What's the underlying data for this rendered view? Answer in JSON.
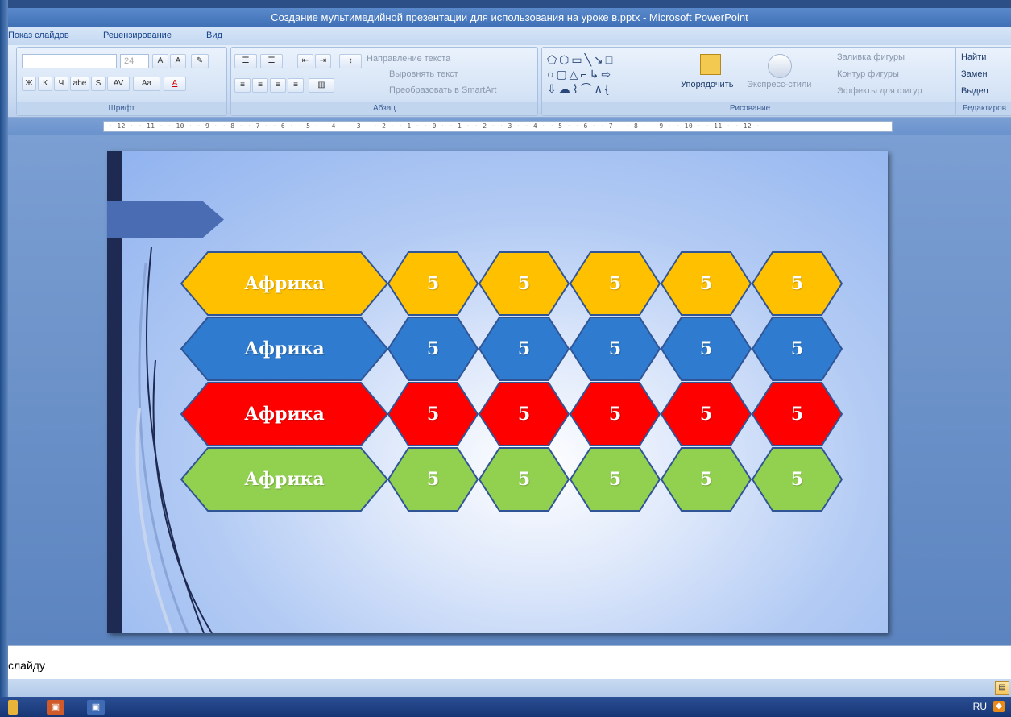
{
  "window": {
    "title": "Создание мультимедийной презентации для использования на уроке в.pptx - Microsoft PowerPoint"
  },
  "menu": {
    "tabs": [
      "Показ слайдов",
      "Рецензирование",
      "Вид"
    ]
  },
  "ribbon": {
    "font_group": {
      "label": "Шрифт",
      "font_size": "24",
      "buttons": [
        "Ж",
        "К",
        "Ч",
        "abe",
        "S",
        "AV",
        "Aa",
        "A"
      ]
    },
    "paragraph_group": {
      "label": "Абзац",
      "text_direction": "Направление текста",
      "align_text": "Выровнять текст",
      "convert_smartart": "Преобразовать в SmartArt"
    },
    "drawing_group": {
      "label": "Рисование",
      "arrange": "Упорядочить",
      "quick_styles": "Экспресс-стили",
      "shape_fill": "Заливка фигуры",
      "shape_outline": "Контур фигуры",
      "shape_effects": "Эффекты для фигур"
    },
    "editing_group": {
      "label": "Редактиров",
      "find": "Найти",
      "replace": "Замен",
      "select": "Выдел"
    }
  },
  "ruler": {
    "text": "· 12 · · 11 · · 10 · · 9 · · 8 · · 7 · · 6 · · 5 · · 4 · · 3 · · 2 · · 1 · · 0 · · 1 · · 2 · · 3 · · 4 · · 5 · · 6 · · 7 · · 8 · · 9 · · 10 · · 11 · · 12 ·"
  },
  "slide": {
    "rows": [
      {
        "color": "#ffc000",
        "label": "Африка",
        "cells": [
          "5",
          "5",
          "5",
          "5",
          "5"
        ]
      },
      {
        "color": "#2e7bcf",
        "label": "Африка",
        "cells": [
          "5",
          "5",
          "5",
          "5",
          "5"
        ]
      },
      {
        "color": "#ff0000",
        "label": "Африка",
        "cells": [
          "5",
          "5",
          "5",
          "5",
          "5"
        ]
      },
      {
        "color": "#92d050",
        "label": "Африка",
        "cells": [
          "5",
          "5",
          "5",
          "5",
          "5"
        ]
      }
    ],
    "outline_color": "#2f5597"
  },
  "notes": {
    "text": "слайду"
  },
  "statusbar": {
    "lang": "RU"
  }
}
